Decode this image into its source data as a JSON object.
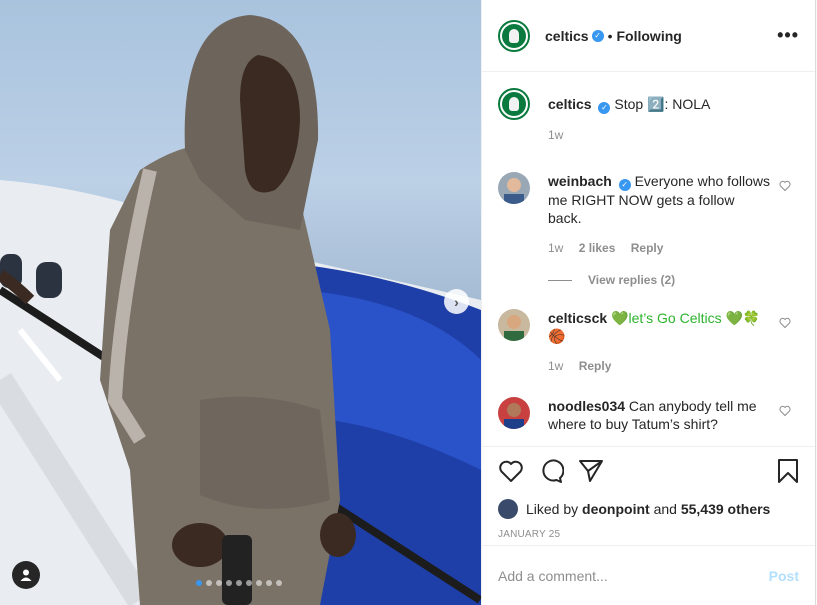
{
  "post": {
    "username": "celtics",
    "following_label": "Following",
    "more_label": "•••",
    "caption": "Stop 2️⃣: NOLA",
    "caption_age": "1w"
  },
  "comments": [
    {
      "username": "weinbach",
      "text": "Everyone who follows me RIGHT NOW gets a follow back.",
      "age": "1w",
      "likes": "2 likes",
      "reply_label": "Reply",
      "view_replies": "View replies (2)"
    },
    {
      "username": "celticsck",
      "text": "💚let’s Go Celtics 💚🍀🏀",
      "age": "1w",
      "reply_label": "Reply"
    },
    {
      "username": "noodles034",
      "text": "Can anybody tell me where to buy Tatum’s shirt?"
    }
  ],
  "likes": {
    "prefix": "Liked by",
    "user": "deonpoint",
    "and": "and",
    "count": "55,439 others"
  },
  "date": "JANUARY 25",
  "add_comment": {
    "placeholder": "Add a comment...",
    "post_label": "Post"
  },
  "carousel": {
    "total": 9,
    "active": 0
  },
  "colors": {
    "accent": "#3897f0",
    "brand_green": "#0b7a3e",
    "post_disabled": "#b2dffc"
  },
  "icons": [
    "heart-icon",
    "comment-icon",
    "share-icon",
    "bookmark-icon",
    "more-icon",
    "verified-icon",
    "user-tag-icon",
    "next-arrow-icon"
  ]
}
